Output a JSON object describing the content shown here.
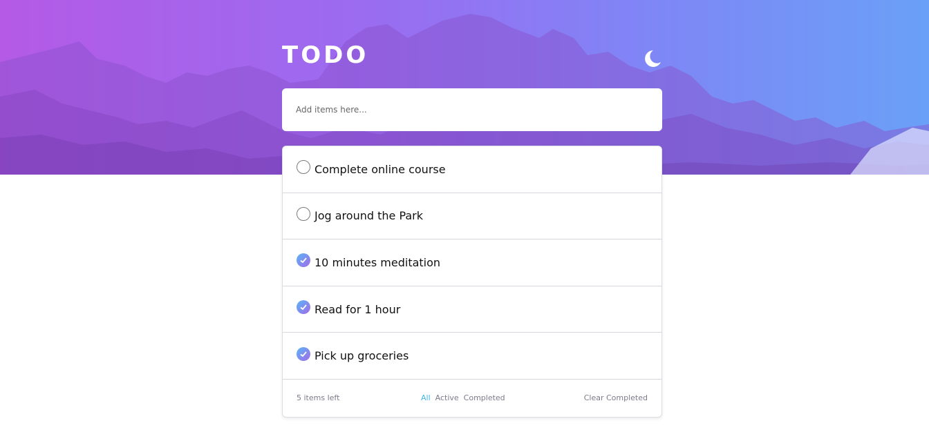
{
  "header": {
    "title": "TODO",
    "theme_icon": "moon-icon"
  },
  "add_input": {
    "placeholder": "Add items here..."
  },
  "todos": [
    {
      "text": "Complete online course",
      "completed": false
    },
    {
      "text": "Jog around the Park",
      "completed": false
    },
    {
      "text": "10 minutes meditation",
      "completed": true
    },
    {
      "text": "Read for 1 hour",
      "completed": true
    },
    {
      "text": "Pick up groceries",
      "completed": true
    }
  ],
  "footer": {
    "items_left": "5 items left",
    "filters": [
      "All",
      "Active",
      "Completed"
    ],
    "active_filter": "All",
    "clear_label": "Clear Completed"
  },
  "colors": {
    "accent": "#3fb6e8",
    "gradient_start": "#58b6f6",
    "gradient_end": "#a46ae8"
  }
}
